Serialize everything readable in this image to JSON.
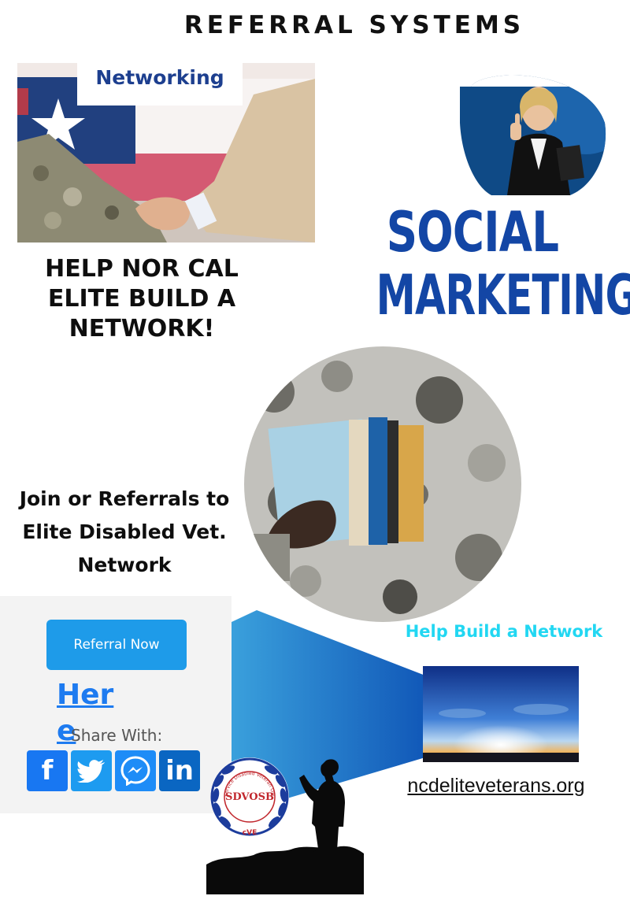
{
  "page": {
    "title": "REFERRAL SYSTEMS"
  },
  "networking": {
    "label": "Networking",
    "heading": "HELP NOR CAL ELITE BUILD A NETWORK!"
  },
  "social": {
    "line1": "SOCIAL",
    "line2": "MARKETING"
  },
  "join": {
    "heading": "Join or Referrals to Elite Disabled Vet. Network"
  },
  "share_panel": {
    "referral_button": "Referral Now",
    "here_link": "Here",
    "share_with": "Share With:",
    "icons": [
      "facebook-icon",
      "twitter-icon",
      "messenger-icon",
      "linkedin-icon"
    ]
  },
  "cta": {
    "help_build": "Help Build a Network",
    "url": "ncdeliteveterans.org"
  },
  "badge": {
    "code": "SDVOSB",
    "ring_text": "Service Disabled Veteran Owned Small Business",
    "mark": "cVE"
  },
  "colors": {
    "brand_blue": "#1346a5",
    "button_blue": "#1e9be9",
    "accent_cyan": "#22d7f2",
    "link_blue": "#1e7bf0"
  }
}
